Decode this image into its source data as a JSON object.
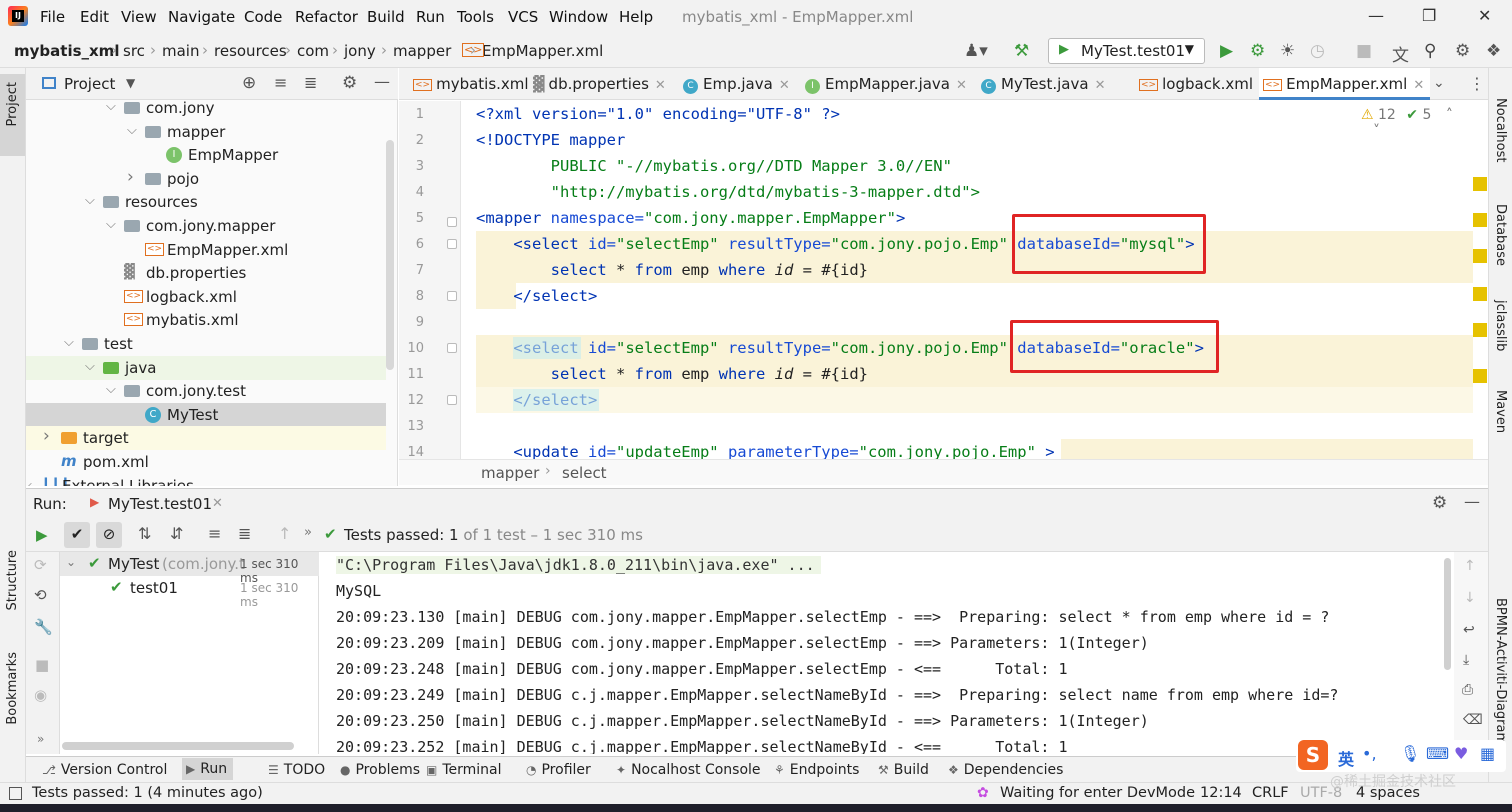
{
  "menubar": {
    "items": [
      "File",
      "Edit",
      "View",
      "Navigate",
      "Code",
      "Refactor",
      "Build",
      "Run",
      "Tools",
      "VCS",
      "Window",
      "Help"
    ],
    "window_title": "mybatis_xml - EmpMapper.xml"
  },
  "navbar": {
    "breadcrumbs": [
      "mybatis_xml",
      "src",
      "main",
      "resources",
      "com",
      "jony",
      "mapper",
      "EmpMapper.xml"
    ],
    "run_config": "MyTest.test01"
  },
  "project": {
    "title": "Project",
    "tree": [
      {
        "label": "com.jony",
        "depth": 3,
        "icon": "folder",
        "arrow": "down"
      },
      {
        "label": "mapper",
        "depth": 4,
        "icon": "folder",
        "arrow": "down"
      },
      {
        "label": "EmpMapper",
        "depth": 5,
        "icon": "interface",
        "arrow": ""
      },
      {
        "label": "pojo",
        "depth": 4,
        "icon": "folder",
        "arrow": "right"
      },
      {
        "label": "resources",
        "depth": 2,
        "icon": "res-folder",
        "arrow": "down"
      },
      {
        "label": "com.jony.mapper",
        "depth": 3,
        "icon": "folder",
        "arrow": "down"
      },
      {
        "label": "EmpMapper.xml",
        "depth": 4,
        "icon": "xml",
        "arrow": ""
      },
      {
        "label": "db.properties",
        "depth": 3,
        "icon": "props",
        "arrow": ""
      },
      {
        "label": "logback.xml",
        "depth": 3,
        "icon": "xml",
        "arrow": ""
      },
      {
        "label": "mybatis.xml",
        "depth": 3,
        "icon": "xml",
        "arrow": ""
      },
      {
        "label": "test",
        "depth": 1,
        "icon": "folder",
        "arrow": "down"
      },
      {
        "label": "java",
        "depth": 2,
        "icon": "test-folder",
        "arrow": "down"
      },
      {
        "label": "com.jony.test",
        "depth": 3,
        "icon": "folder",
        "arrow": "down"
      },
      {
        "label": "MyTest",
        "depth": 4,
        "icon": "class",
        "arrow": ""
      },
      {
        "label": "target",
        "depth": 0,
        "icon": "target-folder",
        "arrow": "right"
      },
      {
        "label": "pom.xml",
        "depth": 0,
        "icon": "maven",
        "arrow": ""
      },
      {
        "label": "External Libraries",
        "depth": -1,
        "icon": "lib",
        "arrow": "down"
      }
    ]
  },
  "tabs": [
    {
      "label": "mybatis.xml",
      "icon": "xml"
    },
    {
      "label": "db.properties",
      "icon": "props"
    },
    {
      "label": "Emp.java",
      "icon": "class"
    },
    {
      "label": "EmpMapper.java",
      "icon": "interface"
    },
    {
      "label": "MyTest.java",
      "icon": "class"
    },
    {
      "label": "logback.xml",
      "icon": "xml"
    },
    {
      "label": "EmpMapper.xml",
      "icon": "xml",
      "active": true
    }
  ],
  "editor": {
    "warnings": "12",
    "checks": "5",
    "line_numbers": [
      "1",
      "2",
      "3",
      "4",
      "5",
      "6",
      "7",
      "8",
      "9",
      "10",
      "11",
      "12",
      "13",
      "14"
    ],
    "lines": {
      "l1": "<?xml version=\"1.0\" encoding=\"UTF-8\" ?>",
      "l2": "<!DOCTYPE mapper",
      "l3": "        PUBLIC \"-//mybatis.org//DTD Mapper 3.0//EN\"",
      "l4": "        \"http://mybatis.org/dtd/mybatis-3-mapper.dtd\">",
      "l5_tag": "<mapper ",
      "l5_attr": "namespace=",
      "l5_val": "\"com.jony.mapper.EmpMapper\"",
      "l5_end": ">",
      "l6_tag": "    <select ",
      "l6_a1": "id=",
      "l6_v1": "\"selectEmp\" ",
      "l6_a2": "resultType=",
      "l6_v2": "\"com.jony.pojo.Emp\" ",
      "l6_a3": "databaseId=",
      "l6_v3": "\"mysql\"",
      "l6_end": ">",
      "l7_kw1": "        select ",
      "l7_t1": "* ",
      "l7_kw2": "from ",
      "l7_t2": "emp ",
      "l7_kw3": "where ",
      "l7_id": "id",
      "l7_t3": " = #{id}",
      "l8": "    </select>",
      "l10_tag": "    <select ",
      "l10_a1": "id=",
      "l10_v1": "\"selectEmp\" ",
      "l10_a2": "resultType=",
      "l10_v2": "\"com.jony.pojo.Emp\" ",
      "l10_a3": "databaseId=",
      "l10_v3": "\"oracle\"",
      "l10_end": ">",
      "l11_kw1": "        select ",
      "l11_t1": "* ",
      "l11_kw2": "from ",
      "l11_t2": "emp ",
      "l11_kw3": "where ",
      "l11_id": "id",
      "l11_t3": " = #{id}",
      "l12": "    </select>",
      "l14_tag": "    <update ",
      "l14_a1": "id=",
      "l14_v1": "\"updateEmp\" ",
      "l14_a2": "parameterType=",
      "l14_v2": "\"com.jony.pojo.Emp\" ",
      "l14_end": ">"
    },
    "crumbs": [
      "mapper",
      "select"
    ]
  },
  "run": {
    "label": "Run:",
    "tab": "MyTest.test01",
    "status_prefix": "Tests passed: ",
    "status_count": "1",
    "status_suffix": " of 1 test – 1 sec 310 ms",
    "tests": [
      {
        "name": "MyTest",
        "detail": "(com.jony.t",
        "time": "1 sec 310 ms"
      },
      {
        "name": "test01",
        "detail": "",
        "time": "1 sec 310 ms"
      }
    ],
    "console": [
      "\"C:\\Program Files\\Java\\jdk1.8.0_211\\bin\\java.exe\" ...",
      "MySQL",
      "20:09:23.130 [main] DEBUG com.jony.mapper.EmpMapper.selectEmp - ==>  Preparing: select * from emp where id = ?",
      "20:09:23.209 [main] DEBUG com.jony.mapper.EmpMapper.selectEmp - ==> Parameters: 1(Integer)",
      "20:09:23.248 [main] DEBUG com.jony.mapper.EmpMapper.selectEmp - <==      Total: 1",
      "20:09:23.249 [main] DEBUG c.j.mapper.EmpMapper.selectNameById - ==>  Preparing: select name from emp where id=?",
      "20:09:23.250 [main] DEBUG c.j.mapper.EmpMapper.selectNameById - ==> Parameters: 1(Integer)",
      "20:09:23.252 [main] DEBUG c.j.mapper.EmpMapper.selectNameById - <==      Total: 1"
    ]
  },
  "toolwindows": [
    "Version Control",
    "Run",
    "TODO",
    "Problems",
    "Terminal",
    "Profiler",
    "Nocalhost Console",
    "Endpoints",
    "Build",
    "Dependencies"
  ],
  "left_strip": [
    "Project",
    "Structure",
    "Bookmarks"
  ],
  "right_strip": [
    "Nocalhost",
    "Database",
    "jclasslib",
    "Maven",
    "BPMN-Activiti-Diagram"
  ],
  "statusbar": {
    "message": "Tests passed: 1 (4 minutes ago)",
    "devmode": "Waiting for enter DevMode",
    "position": "12:14",
    "line_sep": "CRLF",
    "encoding": "UTF-8",
    "indent": "4 spaces",
    "watermark": "@稀土掘金技术社区",
    "ime": "英"
  },
  "colors": {
    "accent": "#4083c9",
    "highlight": "#faf3d8",
    "redbox": "#e02424",
    "pass": "#3c9a3c"
  }
}
